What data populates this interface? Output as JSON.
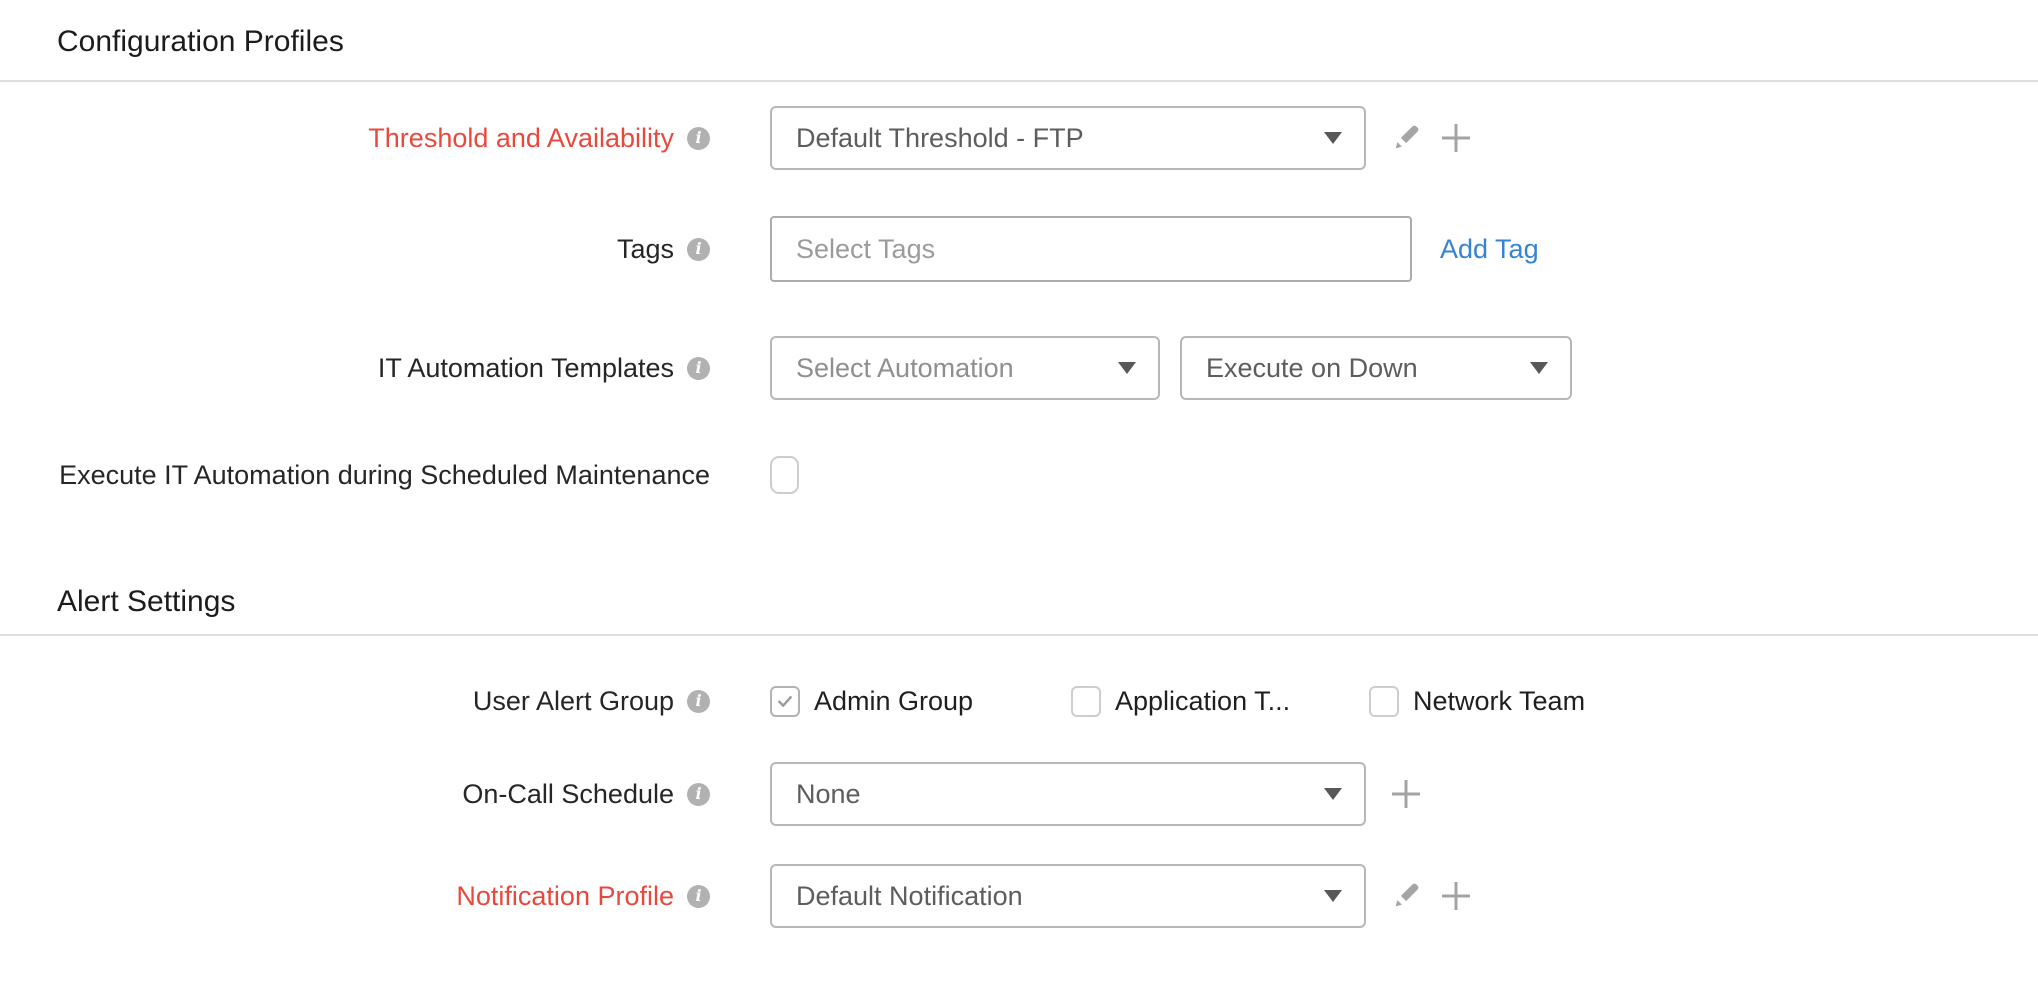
{
  "icons": {
    "info": "i"
  },
  "colors": {
    "required_label": "#e8493c",
    "link": "#3583d2"
  },
  "config_profiles": {
    "title": "Configuration Profiles",
    "threshold": {
      "label": "Threshold and Availability",
      "value": "Default Threshold - FTP"
    },
    "tags": {
      "label": "Tags",
      "placeholder": "Select Tags",
      "add_tag_label": "Add Tag"
    },
    "it_automation": {
      "label": "IT Automation Templates",
      "automation_placeholder": "Select Automation",
      "trigger_value": "Execute on Down"
    },
    "maintenance_toggle": {
      "label": "Execute IT Automation during Scheduled Maintenance",
      "checked": false
    }
  },
  "alert_settings": {
    "title": "Alert Settings",
    "user_alert_group": {
      "label": "User Alert Group",
      "options": [
        {
          "label": "Admin Group",
          "checked": true
        },
        {
          "label": "Application T...",
          "checked": false
        },
        {
          "label": "Network Team",
          "checked": false
        }
      ]
    },
    "on_call_schedule": {
      "label": "On-Call Schedule",
      "value": "None"
    },
    "notification_profile": {
      "label": "Notification Profile",
      "value": "Default Notification"
    }
  }
}
